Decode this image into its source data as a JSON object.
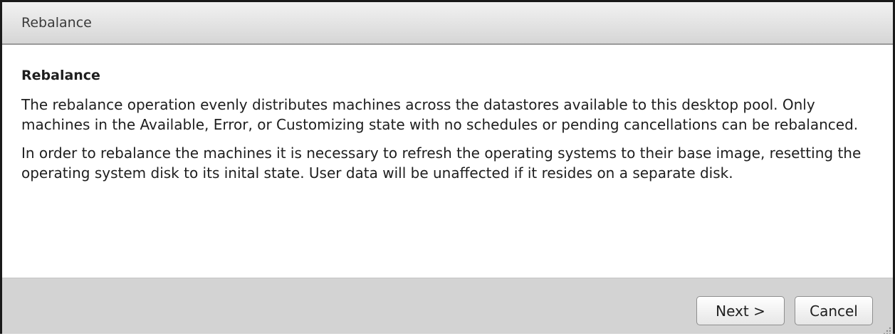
{
  "window": {
    "title": "Rebalance"
  },
  "content": {
    "heading": "Rebalance",
    "paragraph1": "The rebalance operation evenly distributes machines across the datastores available to this desktop pool. Only machines in the Available, Error, or Customizing state with no schedules or pending cancellations can be rebalanced.",
    "paragraph2": "In order to rebalance the machines it is necessary to refresh the operating systems to their base image, resetting the operating system disk to its inital state. User data will be unaffected if it resides on a separate disk."
  },
  "footer": {
    "next_label": "Next >",
    "cancel_label": "Cancel"
  },
  "icons": {
    "resize_grip": "resize-grip-icon"
  }
}
